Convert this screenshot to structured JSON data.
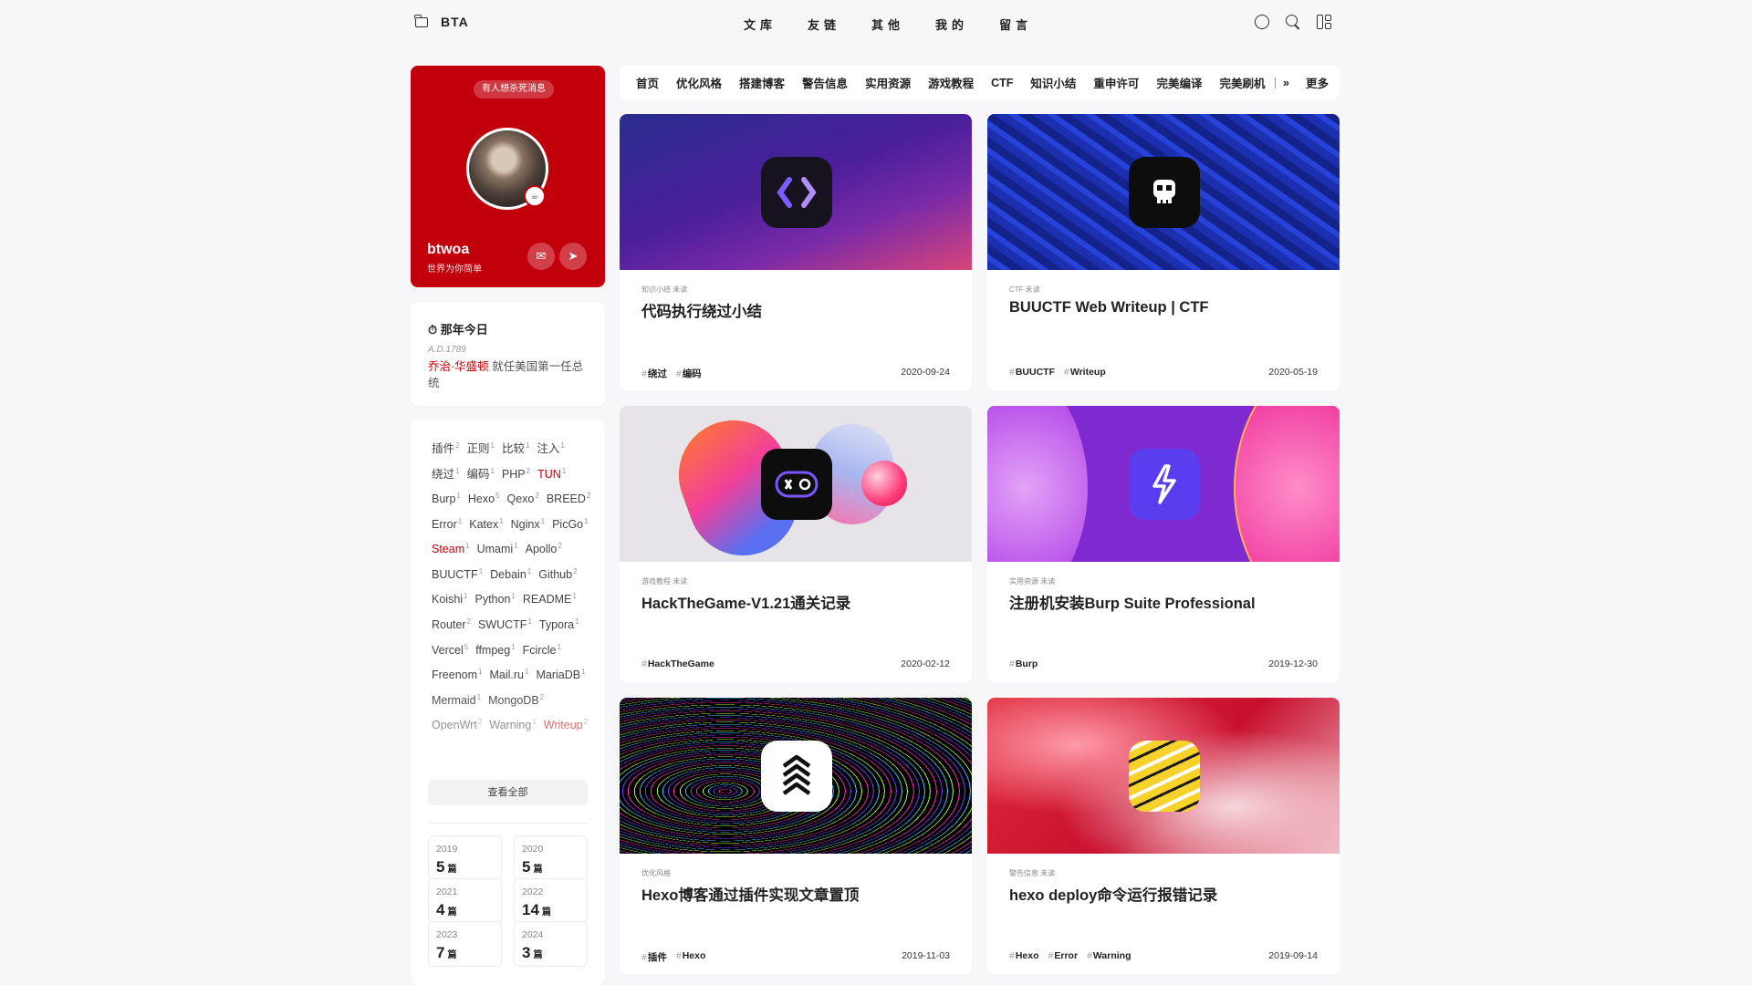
{
  "nav": {
    "brand": "BTA",
    "menu": [
      "文库",
      "友链",
      "其他",
      "我的",
      "留言"
    ]
  },
  "profile": {
    "badge": "有人想杀死消息",
    "name": "btwoa",
    "motto": "世界为你简单"
  },
  "today": {
    "title": "⏱ 那年今日",
    "date": "A.D.1789",
    "highlight": "乔治·华盛顿",
    "text": " 就任美国第一任总统"
  },
  "tags": [
    {
      "name": "插件",
      "count": "2"
    },
    {
      "name": "正则",
      "count": "1"
    },
    {
      "name": "比较",
      "count": "1"
    },
    {
      "name": "注入",
      "count": "1"
    },
    {
      "name": "绕过",
      "count": "1"
    },
    {
      "name": "编码",
      "count": "1"
    },
    {
      "name": "PHP",
      "count": "2"
    },
    {
      "name": "TUN",
      "count": "1",
      "red": true
    },
    {
      "name": "Burp",
      "count": "1"
    },
    {
      "name": "Hexo",
      "count": "5"
    },
    {
      "name": "Qexo",
      "count": "2"
    },
    {
      "name": "BREED",
      "count": "2"
    },
    {
      "name": "Error",
      "count": "1"
    },
    {
      "name": "Katex",
      "count": "1"
    },
    {
      "name": "Nginx",
      "count": "1"
    },
    {
      "name": "PicGo",
      "count": "1"
    },
    {
      "name": "Steam",
      "count": "1",
      "red": true
    },
    {
      "name": "Umami",
      "count": "1"
    },
    {
      "name": "Apollo",
      "count": "2"
    },
    {
      "name": "BUUCTF",
      "count": "1"
    },
    {
      "name": "Debain",
      "count": "1"
    },
    {
      "name": "Github",
      "count": "2"
    },
    {
      "name": "Koishi",
      "count": "1"
    },
    {
      "name": "Python",
      "count": "1"
    },
    {
      "name": "README",
      "count": "1"
    },
    {
      "name": "Router",
      "count": "2"
    },
    {
      "name": "SWUCTF",
      "count": "1"
    },
    {
      "name": "Typora",
      "count": "1"
    },
    {
      "name": "Vercel",
      "count": "5"
    },
    {
      "name": "ffmpeg",
      "count": "1"
    },
    {
      "name": "Fcircle",
      "count": "1"
    },
    {
      "name": "Freenom",
      "count": "1"
    },
    {
      "name": "Mail.ru",
      "count": "1"
    },
    {
      "name": "MariaDB",
      "count": "1"
    },
    {
      "name": "Mermaid",
      "count": "1"
    },
    {
      "name": "MongoDB",
      "count": "2"
    },
    {
      "name": "OpenWrt",
      "count": "2"
    },
    {
      "name": "Warning",
      "count": "1"
    },
    {
      "name": "Writeup",
      "count": "2",
      "red": true
    }
  ],
  "see_all": "查看全部",
  "archives": [
    {
      "year": "2019",
      "count": "5",
      "unit": "篇"
    },
    {
      "year": "2020",
      "count": "5",
      "unit": "篇"
    },
    {
      "year": "2021",
      "count": "4",
      "unit": "篇"
    },
    {
      "year": "2022",
      "count": "14",
      "unit": "篇"
    },
    {
      "year": "2023",
      "count": "7",
      "unit": "篇"
    },
    {
      "year": "2024",
      "count": "3",
      "unit": "篇"
    }
  ],
  "categories": [
    "首页",
    "优化风格",
    "搭建博客",
    "警告信息",
    "实用资源",
    "游戏教程",
    "CTF",
    "知识小结",
    "重申许可",
    "完美编译",
    "完美刷机"
  ],
  "more_label": "更多",
  "posts": [
    {
      "meta": "知识小结   未读",
      "title": "代码执行绕过小结",
      "tags": [
        "绕过",
        "编码"
      ],
      "date": "2020-09-24"
    },
    {
      "meta": "CTF   未读",
      "title": "BUUCTF Web Writeup | CTF",
      "tags": [
        "BUUCTF",
        "Writeup"
      ],
      "date": "2020-05-19"
    },
    {
      "meta": "游戏教程   未读",
      "title": "HackTheGame-V1.21通关记录",
      "tags": [
        "HackTheGame"
      ],
      "date": "2020-02-12"
    },
    {
      "meta": "实用资源   未读",
      "title": "注册机安装Burp Suite Professional",
      "tags": [
        "Burp"
      ],
      "date": "2019-12-30"
    },
    {
      "meta": "优化风格",
      "title": "Hexo博客通过插件实现文章置顶",
      "tags": [
        "插件",
        "Hexo"
      ],
      "date": "2019-11-03"
    },
    {
      "meta": "警告信息   未读",
      "title": "hexo deploy命令运行报错记录",
      "tags": [
        "Hexo",
        "Error",
        "Warning"
      ],
      "date": "2019-09-14"
    }
  ],
  "colors": {
    "accent": "#c2000b",
    "background": "#f7f7f9"
  }
}
